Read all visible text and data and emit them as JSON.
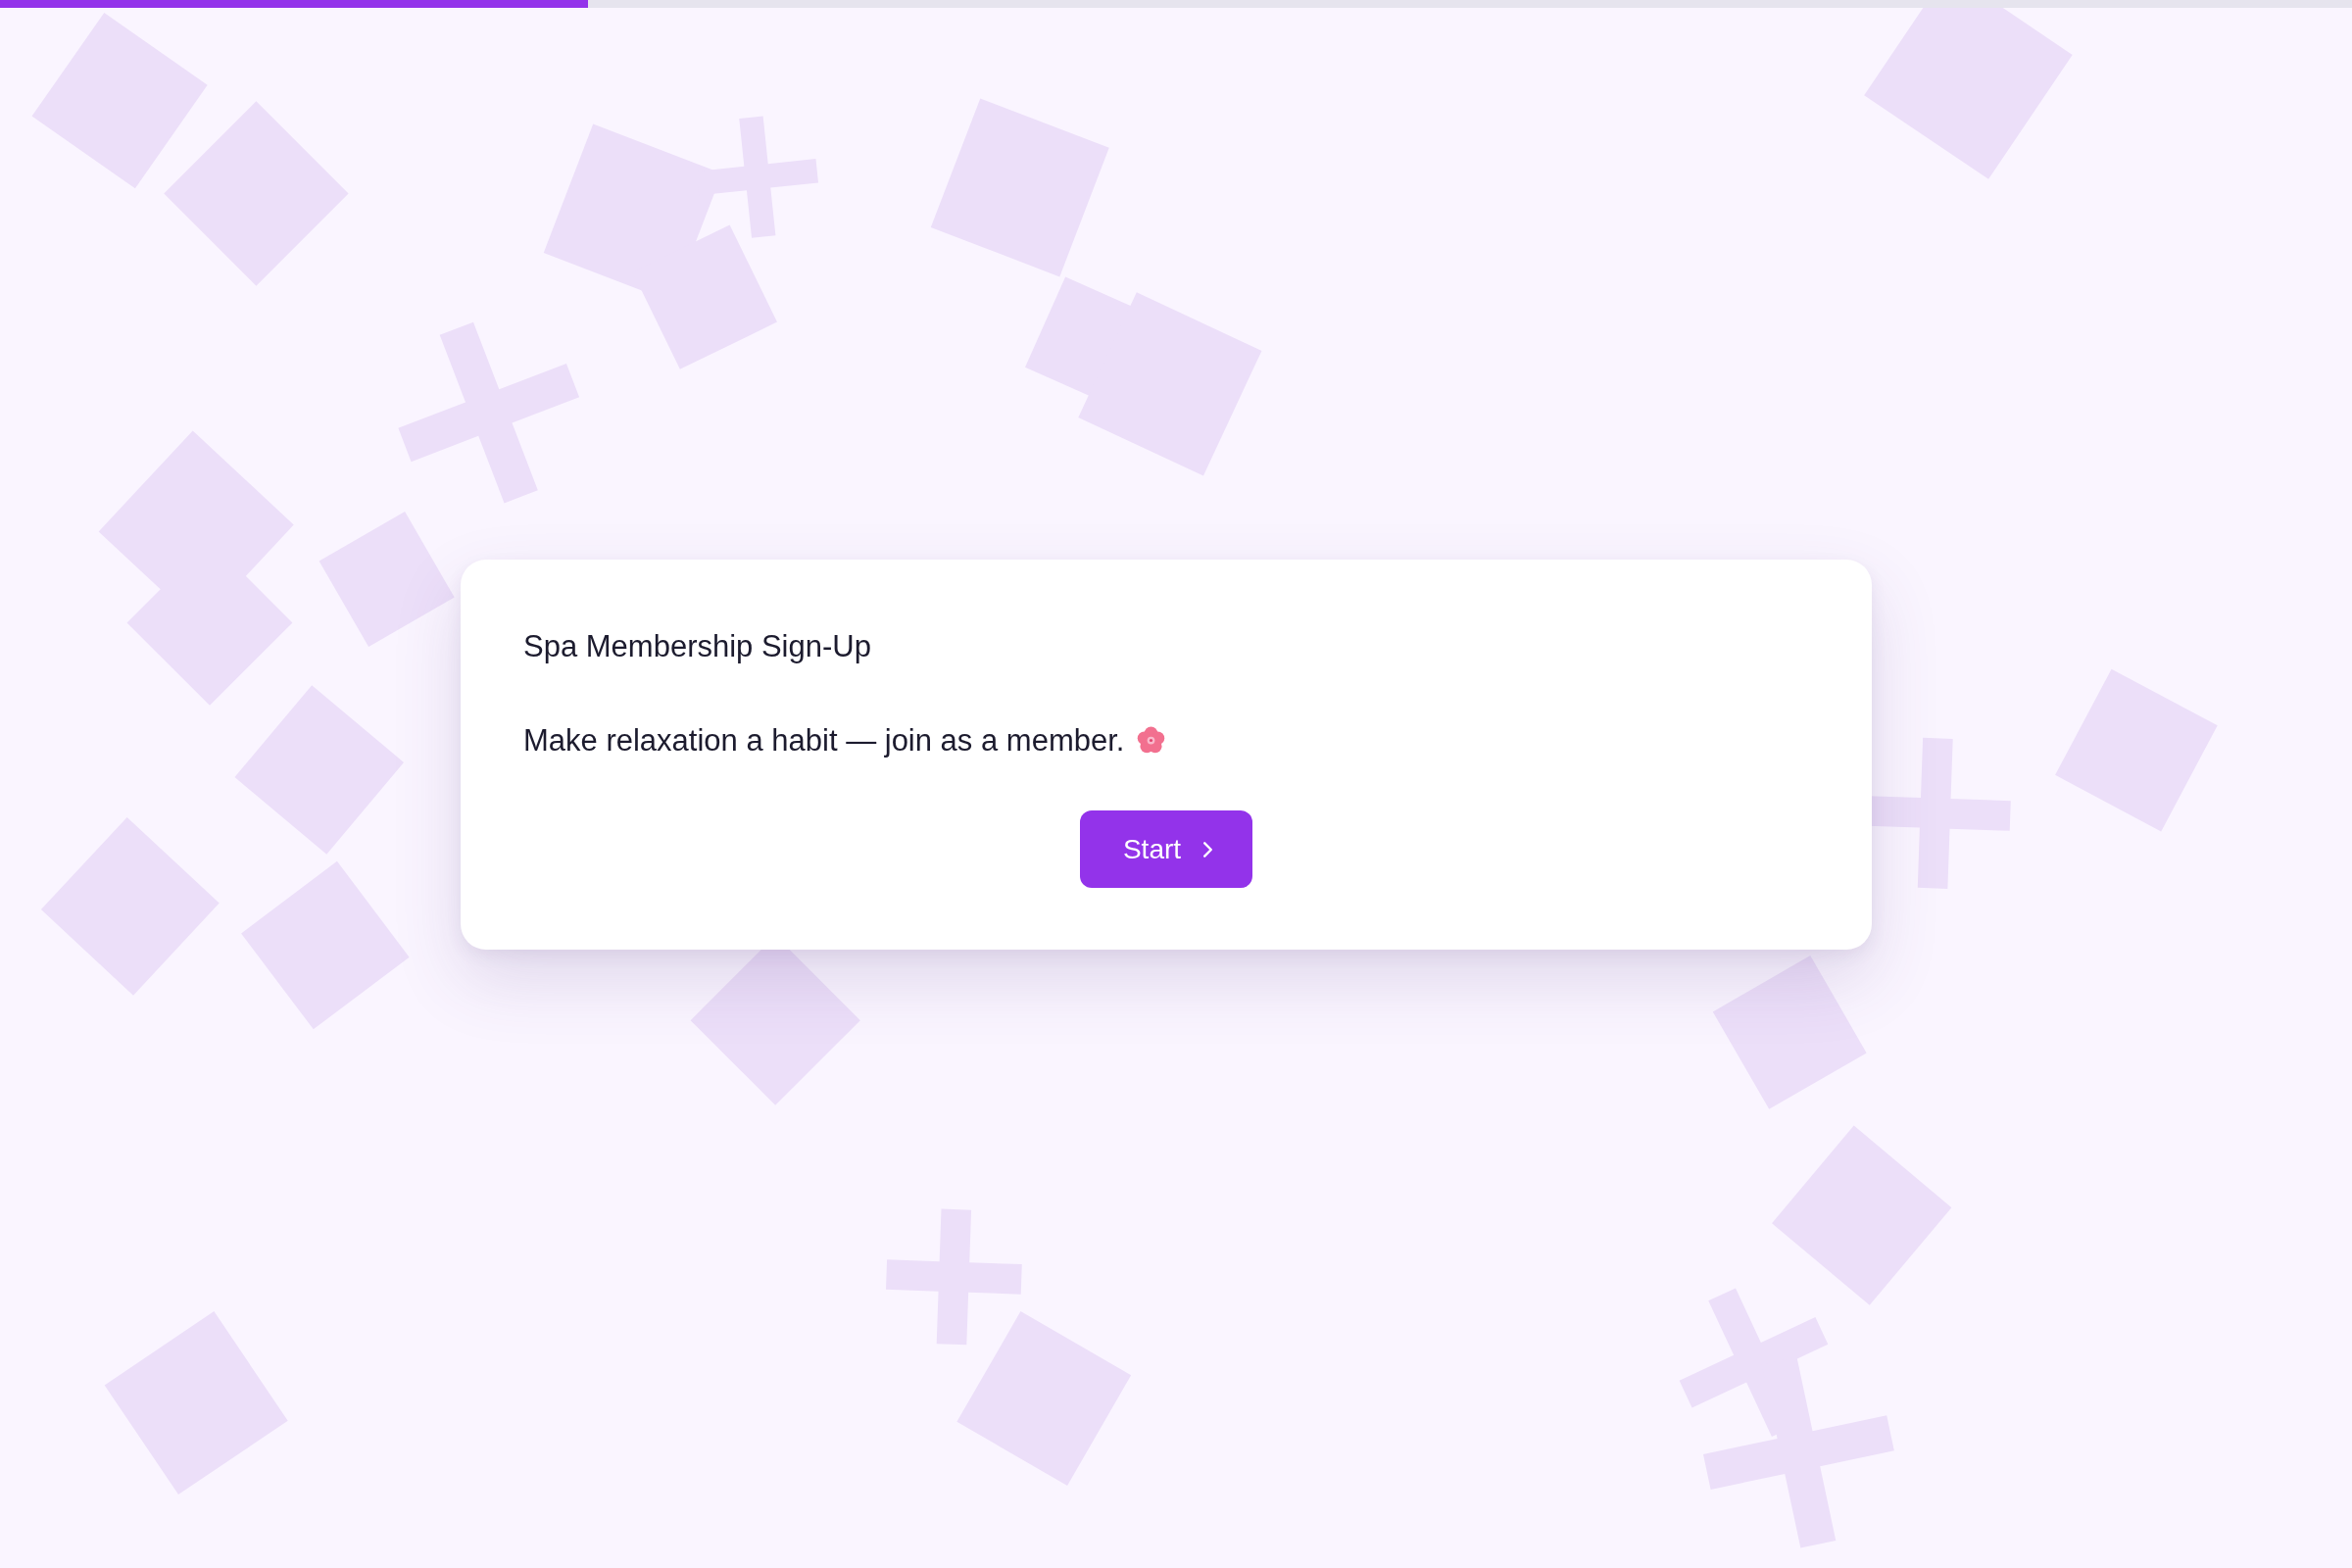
{
  "progress": {
    "level": 0.25
  },
  "card": {
    "title": "Spa Membership Sign-Up",
    "text": "Make relaxation a habit — join as a member.",
    "button": {
      "label": "Start"
    }
  }
}
